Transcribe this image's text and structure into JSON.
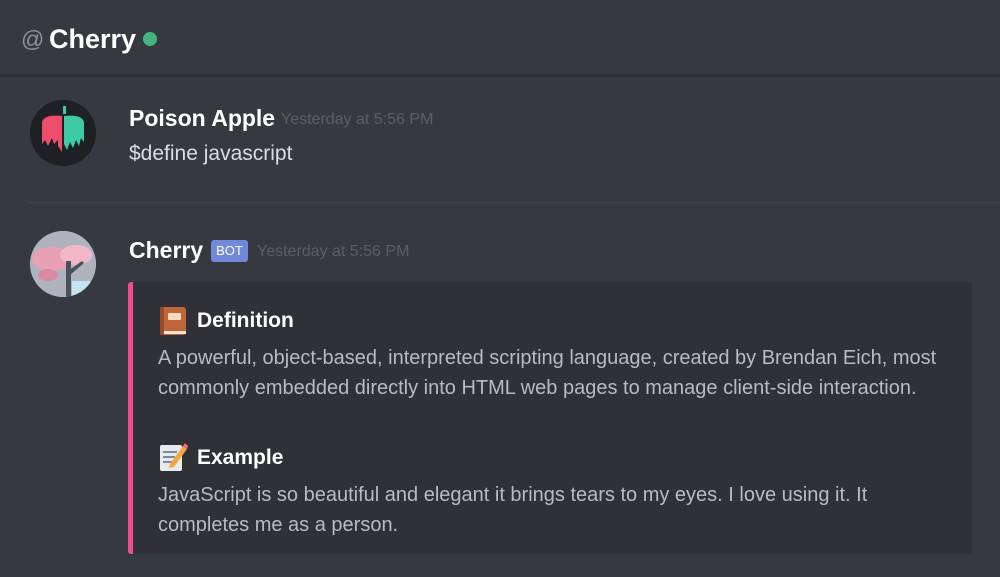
{
  "header": {
    "at_symbol": "@",
    "channel_name": "Cherry",
    "status_color": "#43b581"
  },
  "messages": [
    {
      "author": "Poison Apple",
      "timestamp": "Yesterday at 5:56 PM",
      "content": "$define javascript"
    },
    {
      "author": "Cherry",
      "badge": "BOT",
      "timestamp": "Yesterday at 5:56 PM",
      "embed": {
        "accent_color": "#f04d8d",
        "fields": [
          {
            "icon": "book-icon",
            "name": "Definition",
            "value": "A powerful, object-based, interpreted scripting language, created by Brendan Eich, most commonly embedded directly into HTML web pages to manage client-side interaction."
          },
          {
            "icon": "memo-icon",
            "name": "Example",
            "value": "JavaScript is so beautiful and elegant it brings tears to my eyes. I love using it. It completes me as a person."
          }
        ]
      }
    }
  ]
}
